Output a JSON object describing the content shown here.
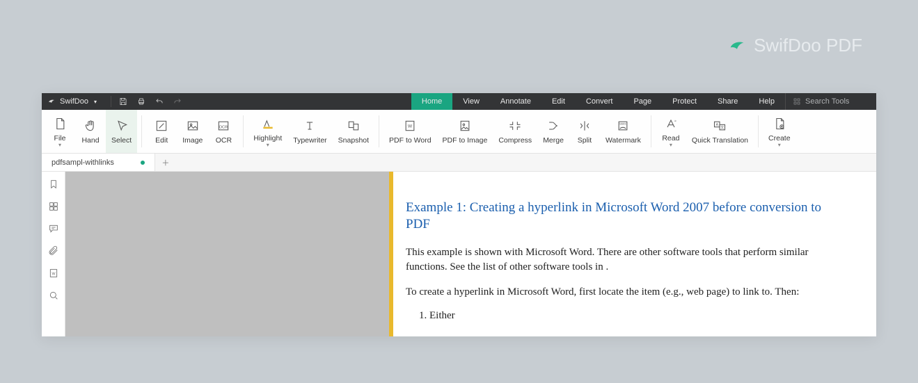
{
  "brand": {
    "name": "SwifDoo PDF"
  },
  "titlebar": {
    "app_name": "SwifDoo"
  },
  "menu": {
    "items": [
      "Home",
      "View",
      "Annotate",
      "Edit",
      "Convert",
      "Page",
      "Protect",
      "Share",
      "Help"
    ],
    "active_index": 0,
    "search_placeholder": "Search Tools"
  },
  "ribbon": {
    "groups": [
      {
        "buttons": [
          {
            "id": "file",
            "label": "File",
            "drop": true
          },
          {
            "id": "hand",
            "label": "Hand"
          },
          {
            "id": "select",
            "label": "Select",
            "selected": true
          }
        ]
      },
      {
        "buttons": [
          {
            "id": "edit",
            "label": "Edit"
          },
          {
            "id": "image",
            "label": "Image"
          },
          {
            "id": "ocr",
            "label": "OCR"
          }
        ]
      },
      {
        "buttons": [
          {
            "id": "highlight",
            "label": "Highlight",
            "drop": true
          },
          {
            "id": "typewriter",
            "label": "Typewriter"
          },
          {
            "id": "snapshot",
            "label": "Snapshot"
          }
        ]
      },
      {
        "buttons": [
          {
            "id": "pdf-to-word",
            "label": "PDF to Word"
          },
          {
            "id": "pdf-to-image",
            "label": "PDF to Image"
          },
          {
            "id": "compress",
            "label": "Compress"
          },
          {
            "id": "merge",
            "label": "Merge"
          },
          {
            "id": "split",
            "label": "Split"
          },
          {
            "id": "watermark",
            "label": "Watermark"
          }
        ]
      },
      {
        "buttons": [
          {
            "id": "read",
            "label": "Read",
            "drop": true
          },
          {
            "id": "quick-translation",
            "label": "Quick Translation"
          }
        ]
      },
      {
        "buttons": [
          {
            "id": "create",
            "label": "Create",
            "drop": true
          }
        ]
      }
    ]
  },
  "tabs": {
    "items": [
      {
        "title": "pdfsampl-withlinks",
        "modified": true
      }
    ]
  },
  "document": {
    "heading": "Example 1: Creating a hyperlink in Microsoft Word 2007 before conversion to PDF",
    "p1": "This example is shown with Microsoft Word. There are other software tools that perform similar functions. See the list of other software tools in .",
    "p2": "To create a hyperlink in Microsoft Word, first locate the item (e.g., web page) to link to. Then:",
    "li1": "Either"
  }
}
